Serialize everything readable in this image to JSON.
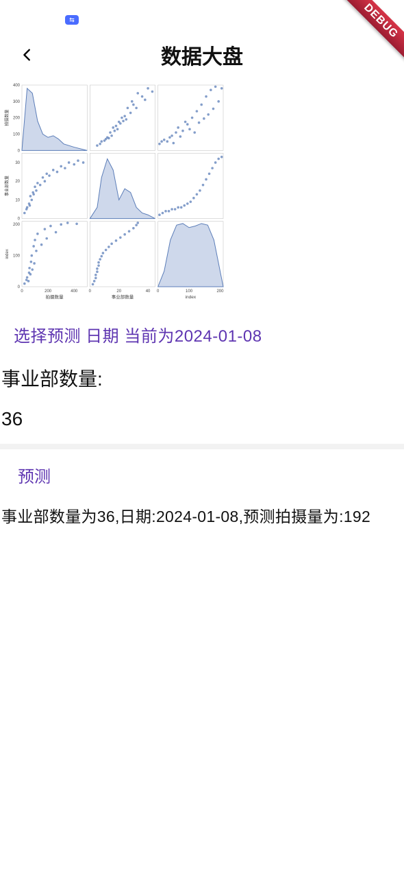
{
  "debug_banner": "DEBUG",
  "header": {
    "title": "数据大盘"
  },
  "date_picker": {
    "label_prefix": "选择预测 日期 当前为",
    "date": "2024-01-08"
  },
  "business_unit": {
    "label": "事业部数量:",
    "value": "36"
  },
  "predict": {
    "button_label": "预测",
    "result": "事业部数量为36,日期:2024-01-08,预测拍摄量为:192"
  },
  "chart_data": [
    {
      "type": "area",
      "position": "row1-col1",
      "xlabel": "拍摄数量",
      "ylabel": "拍摄数量",
      "xlim": [
        0,
        500
      ],
      "ylim": [
        0,
        400
      ],
      "x": [
        0,
        40,
        80,
        120,
        160,
        200,
        240,
        280,
        320,
        400,
        500
      ],
      "y": [
        0,
        380,
        350,
        180,
        100,
        80,
        90,
        70,
        40,
        20,
        0
      ]
    },
    {
      "type": "scatter",
      "position": "row1-col2",
      "xlabel": "事业部数量",
      "ylabel": "拍摄数量",
      "xlim": [
        0,
        45
      ],
      "ylim": [
        0,
        400
      ],
      "points": [
        [
          5,
          30
        ],
        [
          7,
          40
        ],
        [
          8,
          55
        ],
        [
          10,
          60
        ],
        [
          11,
          70
        ],
        [
          12,
          80
        ],
        [
          13,
          75
        ],
        [
          14,
          110
        ],
        [
          15,
          90
        ],
        [
          16,
          140
        ],
        [
          17,
          120
        ],
        [
          18,
          150
        ],
        [
          19,
          130
        ],
        [
          20,
          175
        ],
        [
          21,
          165
        ],
        [
          22,
          200
        ],
        [
          23,
          180
        ],
        [
          24,
          210
        ],
        [
          25,
          190
        ],
        [
          26,
          260
        ],
        [
          28,
          230
        ],
        [
          29,
          300
        ],
        [
          30,
          280
        ],
        [
          32,
          260
        ],
        [
          33,
          350
        ],
        [
          36,
          330
        ],
        [
          38,
          310
        ],
        [
          40,
          380
        ],
        [
          43,
          360
        ]
      ]
    },
    {
      "type": "scatter",
      "position": "row1-col3",
      "xlabel": "index",
      "ylabel": "拍摄数量",
      "xlim": [
        0,
        210
      ],
      "ylim": [
        0,
        400
      ],
      "points": [
        [
          5,
          40
        ],
        [
          12,
          55
        ],
        [
          20,
          65
        ],
        [
          30,
          55
        ],
        [
          38,
          80
        ],
        [
          45,
          90
        ],
        [
          50,
          45
        ],
        [
          58,
          110
        ],
        [
          65,
          140
        ],
        [
          72,
          85
        ],
        [
          80,
          120
        ],
        [
          88,
          175
        ],
        [
          95,
          160
        ],
        [
          102,
          130
        ],
        [
          110,
          200
        ],
        [
          118,
          110
        ],
        [
          125,
          240
        ],
        [
          132,
          170
        ],
        [
          140,
          280
        ],
        [
          148,
          195
        ],
        [
          155,
          330
        ],
        [
          162,
          220
        ],
        [
          170,
          370
        ],
        [
          178,
          255
        ],
        [
          185,
          390
        ],
        [
          195,
          300
        ],
        [
          205,
          380
        ]
      ]
    },
    {
      "type": "scatter",
      "position": "row2-col1",
      "xlabel": "拍摄数量",
      "ylabel": "事业部数量",
      "xlim": [
        0,
        500
      ],
      "ylim": [
        0,
        35
      ],
      "points": [
        [
          20,
          3
        ],
        [
          35,
          5
        ],
        [
          40,
          6
        ],
        [
          55,
          8
        ],
        [
          60,
          7
        ],
        [
          65,
          12
        ],
        [
          75,
          10
        ],
        [
          85,
          14
        ],
        [
          90,
          13
        ],
        [
          100,
          17
        ],
        [
          110,
          15
        ],
        [
          120,
          19
        ],
        [
          140,
          18
        ],
        [
          160,
          22
        ],
        [
          175,
          20
        ],
        [
          190,
          24
        ],
        [
          210,
          23
        ],
        [
          240,
          26
        ],
        [
          270,
          25
        ],
        [
          300,
          28
        ],
        [
          330,
          27
        ],
        [
          360,
          30
        ],
        [
          400,
          29
        ],
        [
          430,
          31
        ],
        [
          470,
          30
        ]
      ]
    },
    {
      "type": "area",
      "position": "row2-col2",
      "xlabel": "事业部数量",
      "ylabel": "事业部数量",
      "xlim": [
        0,
        45
      ],
      "ylim": [
        0,
        35
      ],
      "x": [
        0,
        5,
        8,
        12,
        16,
        20,
        24,
        28,
        32,
        36,
        40,
        45
      ],
      "y": [
        0,
        6,
        22,
        32,
        26,
        10,
        16,
        14,
        6,
        3,
        2,
        0
      ]
    },
    {
      "type": "scatter",
      "position": "row2-col3",
      "xlabel": "index",
      "ylabel": "事业部数量",
      "xlim": [
        0,
        210
      ],
      "ylim": [
        0,
        35
      ],
      "points": [
        [
          5,
          2
        ],
        [
          15,
          3
        ],
        [
          25,
          4
        ],
        [
          35,
          4
        ],
        [
          45,
          5
        ],
        [
          55,
          5
        ],
        [
          65,
          6
        ],
        [
          75,
          6
        ],
        [
          85,
          7
        ],
        [
          95,
          8
        ],
        [
          105,
          9
        ],
        [
          115,
          11
        ],
        [
          125,
          13
        ],
        [
          135,
          15
        ],
        [
          145,
          18
        ],
        [
          155,
          21
        ],
        [
          165,
          24
        ],
        [
          175,
          27
        ],
        [
          185,
          30
        ],
        [
          195,
          32
        ],
        [
          205,
          33
        ]
      ]
    },
    {
      "type": "scatter",
      "position": "row3-col1",
      "xlabel": "拍摄数量",
      "ylabel": "index",
      "xlim": [
        0,
        500
      ],
      "ylim": [
        0,
        210
      ],
      "points": [
        [
          20,
          10
        ],
        [
          35,
          22
        ],
        [
          40,
          30
        ],
        [
          50,
          18
        ],
        [
          55,
          45
        ],
        [
          58,
          60
        ],
        [
          65,
          40
        ],
        [
          70,
          80
        ],
        [
          75,
          100
        ],
        [
          80,
          55
        ],
        [
          90,
          130
        ],
        [
          95,
          75
        ],
        [
          100,
          150
        ],
        [
          110,
          115
        ],
        [
          120,
          170
        ],
        [
          150,
          135
        ],
        [
          175,
          185
        ],
        [
          190,
          155
        ],
        [
          220,
          195
        ],
        [
          260,
          175
        ],
        [
          300,
          200
        ],
        [
          350,
          205
        ],
        [
          420,
          202
        ]
      ]
    },
    {
      "type": "scatter",
      "position": "row3-col2",
      "xlabel": "事业部数量",
      "ylabel": "index",
      "xlim": [
        0,
        45
      ],
      "ylim": [
        0,
        210
      ],
      "points": [
        [
          2,
          8
        ],
        [
          3,
          18
        ],
        [
          4,
          28
        ],
        [
          4,
          38
        ],
        [
          5,
          48
        ],
        [
          5,
          58
        ],
        [
          6,
          68
        ],
        [
          6,
          78
        ],
        [
          7,
          88
        ],
        [
          8,
          98
        ],
        [
          9,
          108
        ],
        [
          11,
          118
        ],
        [
          13,
          128
        ],
        [
          15,
          138
        ],
        [
          18,
          148
        ],
        [
          21,
          158
        ],
        [
          24,
          168
        ],
        [
          27,
          178
        ],
        [
          30,
          188
        ],
        [
          32,
          198
        ],
        [
          33,
          205
        ]
      ]
    },
    {
      "type": "area",
      "position": "row3-col3",
      "xlabel": "index",
      "ylabel": "index",
      "xlim": [
        0,
        210
      ],
      "ylim": [
        0,
        210
      ],
      "x": [
        0,
        20,
        40,
        60,
        80,
        100,
        120,
        140,
        160,
        180,
        200,
        210
      ],
      "y": [
        0,
        50,
        150,
        198,
        203,
        190,
        195,
        203,
        198,
        150,
        50,
        0
      ]
    }
  ]
}
